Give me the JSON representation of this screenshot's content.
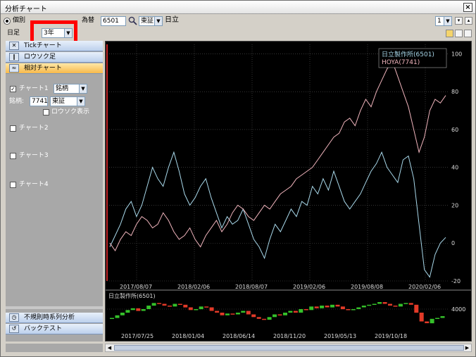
{
  "window": {
    "title": "分析チャート",
    "close_label": "×"
  },
  "toolbar": {
    "mode_label": "個別",
    "switch_label": "為替",
    "code_value": "6501",
    "market_value": "東証",
    "stock_name": "日立",
    "chart_count_value": "1",
    "period_type": "日足",
    "period_value": "3年"
  },
  "sidebar": {
    "menu": [
      {
        "label": "Tickチャート",
        "icon": "tick-chart-icon",
        "active": false
      },
      {
        "label": "ロウソク足",
        "icon": "candlestick-icon",
        "active": false
      },
      {
        "label": "相対チャート",
        "icon": "relative-chart-icon",
        "active": true
      }
    ],
    "chart1_label": "チャート1",
    "chart1_select": "銘柄",
    "brand_label": "銘柄:",
    "brand_code": "7741",
    "brand_market": "東証",
    "candle_show_label": "ロウソク表示",
    "chart2_label": "チャート2",
    "chart3_label": "チャート3",
    "chart4_label": "チャート4",
    "bottom_menu": [
      {
        "label": "不規則時系列分析",
        "icon": "timeseries-icon"
      },
      {
        "label": "バックテスト",
        "icon": "backtest-icon"
      }
    ]
  },
  "chart_data": [
    {
      "type": "line",
      "ylim": [
        -20,
        105
      ],
      "y_ticks": [
        100,
        80,
        60,
        40,
        20,
        0,
        -20
      ],
      "x_tick_labels": [
        "2017/08/07",
        "2018/02/06",
        "2018/08/07",
        "2019/02/06",
        "2019/08/08",
        "2020/02/06"
      ],
      "legend": [
        "日立製作所(6501)",
        "HOYA(7741)"
      ],
      "legend_placement": "top-right",
      "grid": true,
      "series": [
        {
          "name": "日立製作所(6501)",
          "color": "#a8d8ea",
          "values": [
            -2,
            4,
            10,
            18,
            22,
            14,
            20,
            30,
            40,
            34,
            30,
            40,
            48,
            38,
            26,
            20,
            24,
            30,
            34,
            24,
            16,
            8,
            14,
            10,
            12,
            18,
            10,
            2,
            -2,
            -8,
            2,
            10,
            6,
            12,
            18,
            14,
            22,
            20,
            30,
            26,
            34,
            28,
            38,
            30,
            22,
            18,
            22,
            26,
            32,
            38,
            42,
            48,
            40,
            36,
            32,
            44,
            46,
            34,
            10,
            -14,
            -18,
            -6,
            0,
            3
          ]
        },
        {
          "name": "HOYA(7741)",
          "color": "#f0b4bc",
          "values": [
            0,
            -4,
            2,
            6,
            4,
            10,
            14,
            12,
            8,
            10,
            16,
            12,
            6,
            2,
            4,
            8,
            2,
            -2,
            4,
            8,
            12,
            6,
            10,
            16,
            20,
            18,
            14,
            12,
            16,
            20,
            18,
            22,
            26,
            28,
            30,
            34,
            36,
            38,
            40,
            44,
            48,
            52,
            56,
            58,
            64,
            66,
            62,
            70,
            76,
            72,
            80,
            86,
            92,
            96,
            88,
            80,
            72,
            60,
            48,
            56,
            70,
            76,
            74,
            78
          ]
        }
      ]
    },
    {
      "type": "bar",
      "title": "日立製作所(6501)",
      "y_ticks": [
        4000
      ],
      "x_tick_labels": [
        "2017/07/25",
        "2018/01/04",
        "2018/06/14",
        "2018/11/20",
        "2019/05/13",
        "2019/10/18"
      ],
      "colors": {
        "up": "#35c02a",
        "down": "#e23a28"
      },
      "values": [
        3500,
        3650,
        3800,
        3950,
        4050,
        3900,
        4000,
        4200,
        4350,
        4300,
        4200,
        4150,
        4300,
        4250,
        4100,
        3950,
        4000,
        4150,
        4100,
        3900,
        3800,
        3650,
        3750,
        3700,
        3800,
        3900,
        3700,
        3550,
        3450,
        3400,
        3550,
        3700,
        3650,
        3800,
        3900,
        3800,
        4000,
        3950,
        4150,
        4050,
        4200,
        4100,
        4250,
        4150,
        4000,
        3950,
        4000,
        4100,
        4200,
        4250,
        4300,
        4400,
        4300,
        4200,
        4150,
        4300,
        4350,
        4250,
        3800,
        3300,
        3200,
        3450,
        3500,
        3600
      ]
    }
  ]
}
